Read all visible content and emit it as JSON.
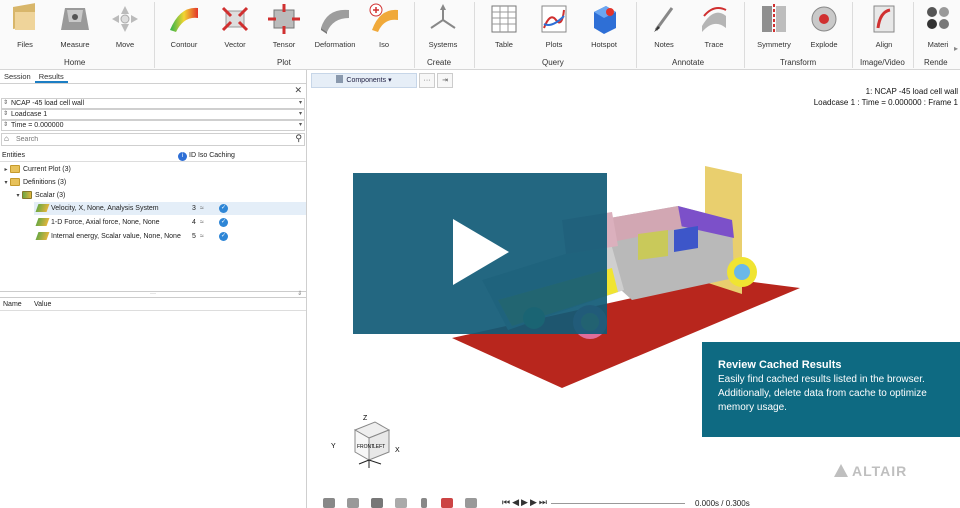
{
  "ribbon": {
    "tools": [
      {
        "label": "Files",
        "icon": "files-icon"
      },
      {
        "label": "Measure",
        "icon": "measure-icon"
      },
      {
        "label": "Move",
        "icon": "move-icon"
      },
      {
        "label": "Contour",
        "icon": "contour-icon"
      },
      {
        "label": "Vector",
        "icon": "vector-icon"
      },
      {
        "label": "Tensor",
        "icon": "tensor-icon"
      },
      {
        "label": "Deformation",
        "icon": "deformation-icon"
      },
      {
        "label": "Iso",
        "icon": "iso-icon"
      },
      {
        "label": "Systems",
        "icon": "systems-icon"
      },
      {
        "label": "Table",
        "icon": "table-icon"
      },
      {
        "label": "Plots",
        "icon": "plots-icon"
      },
      {
        "label": "Hotspot",
        "icon": "hotspot-icon"
      },
      {
        "label": "Notes",
        "icon": "notes-icon"
      },
      {
        "label": "Trace",
        "icon": "trace-icon"
      },
      {
        "label": "Symmetry",
        "icon": "symmetry-icon"
      },
      {
        "label": "Explode",
        "icon": "explode-icon"
      },
      {
        "label": "Align",
        "icon": "align-icon"
      },
      {
        "label": "Materi",
        "icon": "materials-icon"
      }
    ],
    "groups": [
      "Home",
      "Plot",
      "Create",
      "Query",
      "Annotate",
      "Transform",
      "Image/Video",
      "Rende"
    ]
  },
  "browser": {
    "tabs": [
      "Session",
      "Results"
    ],
    "active_tab": "Results",
    "model_select": "NCAP -45 load cell wall",
    "loadcase_select": "Loadcase 1",
    "time_select": "Time = 0.000000",
    "search_placeholder": "Search",
    "entities_header": "Entities",
    "columns_header": "ID Iso Caching",
    "tree": {
      "current_plot": "Current Plot (3)",
      "definitions": "Definitions (3)",
      "scalar": "Scalar (3)"
    },
    "results": [
      {
        "label": "Velocity, X, None, Analysis System",
        "id": "3"
      },
      {
        "label": "1-D Force, Axial force, None, None",
        "id": "4"
      },
      {
        "label": "Internal energy, Scalar value, None, None",
        "id": "5"
      }
    ],
    "props_name": "Name",
    "props_value": "Value"
  },
  "viewport": {
    "components_label": "Components",
    "more_label": "···",
    "model_title": "1: NCAP -45 load cell wall",
    "loadcase_line": "Loadcase 1 : Time = 0.000000 : Frame 1",
    "cube_front": "FRONT",
    "cube_left": "LEFT",
    "axis_z": "Z",
    "axis_y": "Y",
    "axis_x": "X",
    "time_readout": "0.000s / 0.300s"
  },
  "overlay": {
    "title": "Review Cached Results",
    "body": "Easily find cached results listed in the browser. Additionally, delete data from cache to optimize memory usage.",
    "brand": "ALTAIR"
  },
  "colors": {
    "play_overlay": "#105a76",
    "info_box": "#0e6a82",
    "accent": "#1c7ec4"
  }
}
